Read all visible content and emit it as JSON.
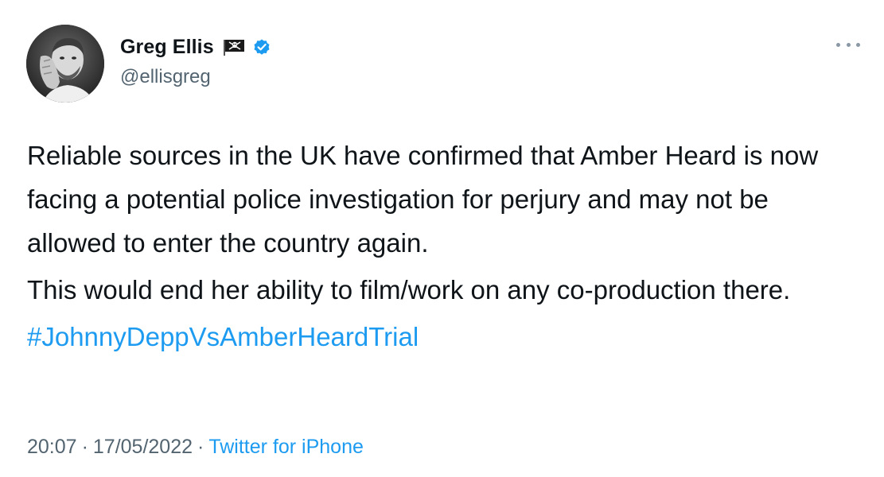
{
  "author": {
    "display_name": "Greg Ellis",
    "handle": "@ellisgreg",
    "verified": true,
    "name_emoji": "pirate-flag"
  },
  "tweet": {
    "paragraphs": [
      "Reliable sources in the UK have confirmed that Amber Heard is now facing a potential police investigation for perjury and may not be allowed to enter the country again.",
      "This would end her ability to film/work on any co-production there."
    ],
    "hashtag": "#JohnnyDeppVsAmberHeardTrial"
  },
  "meta": {
    "time": "20:07",
    "separator": "·",
    "date": "17/05/2022",
    "source": "Twitter for iPhone"
  },
  "colors": {
    "text": "#0f1419",
    "secondary": "#536471",
    "link": "#1d9bf0",
    "verified": "#1d9bf0"
  },
  "icons": {
    "more": "more-dots-icon",
    "verified": "verified-badge-icon",
    "flag": "pirate-flag-icon"
  }
}
